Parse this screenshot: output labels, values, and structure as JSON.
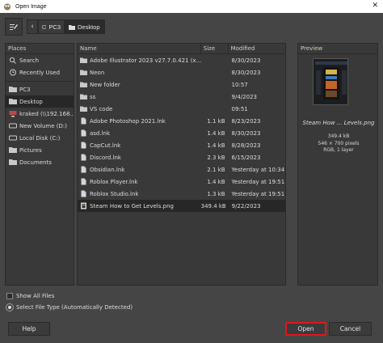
{
  "window": {
    "title": "Open Image"
  },
  "breadcrumb": [
    {
      "label": "PC3",
      "icon": "drive-icon"
    },
    {
      "label": "Desktop",
      "icon": "folder-icon"
    }
  ],
  "places": {
    "header": "Places",
    "items": [
      {
        "label": "Search",
        "icon": "search-icon"
      },
      {
        "label": "Recently Used",
        "icon": "clock-icon"
      },
      {
        "label": "PC3",
        "icon": "folder-icon"
      },
      {
        "label": "Desktop",
        "icon": "folder-icon",
        "selected": true
      },
      {
        "label": "kraked (\\\\192.168....",
        "icon": "network-drive-icon"
      },
      {
        "label": "New Volume (D:)",
        "icon": "drive-icon"
      },
      {
        "label": "Local Disk (C:)",
        "icon": "drive-icon"
      },
      {
        "label": "Pictures",
        "icon": "folder-icon"
      },
      {
        "label": "Documents",
        "icon": "folder-icon"
      }
    ]
  },
  "files": {
    "headers": {
      "name": "Name",
      "size": "Size",
      "modified": "Modified"
    },
    "rows": [
      {
        "name": "Adobe Illustrator 2023 v27.7.0.421 (x...",
        "size": "",
        "modified": "8/30/2023",
        "icon": "folder-icon"
      },
      {
        "name": "Neon",
        "size": "",
        "modified": "8/30/2023",
        "icon": "folder-icon"
      },
      {
        "name": "New folder",
        "size": "",
        "modified": "10:57",
        "icon": "folder-icon"
      },
      {
        "name": "ss",
        "size": "",
        "modified": "9/4/2023",
        "icon": "folder-icon"
      },
      {
        "name": "VS code",
        "size": "",
        "modified": "09:51",
        "icon": "folder-icon"
      },
      {
        "name": "Adobe Photoshop 2021.lnk",
        "size": "1.1 kB",
        "modified": "8/23/2023",
        "icon": "file-icon"
      },
      {
        "name": "asd.lnk",
        "size": "1.4 kB",
        "modified": "8/30/2023",
        "icon": "file-icon"
      },
      {
        "name": "CapCut.lnk",
        "size": "1.4 kB",
        "modified": "8/28/2023",
        "icon": "file-icon"
      },
      {
        "name": "Discord.lnk",
        "size": "2.3 kB",
        "modified": "6/15/2023",
        "icon": "file-icon"
      },
      {
        "name": "Obsidian.lnk",
        "size": "2.1 kB",
        "modified": "Yesterday at 10:34",
        "icon": "file-icon"
      },
      {
        "name": "Roblox Player.lnk",
        "size": "1.4 kB",
        "modified": "Yesterday at 19:51",
        "icon": "file-icon"
      },
      {
        "name": "Roblox Studio.lnk",
        "size": "1.3 kB",
        "modified": "Yesterday at 19:51",
        "icon": "file-icon"
      },
      {
        "name": "Steam How to Get Levels.png",
        "size": "349.4 kB",
        "modified": "9/22/2023",
        "icon": "image-file-icon",
        "selected": true
      }
    ]
  },
  "preview": {
    "header": "Preview",
    "name": "Steam How ... Levels.png",
    "size": "349.4 kB",
    "dimensions": "546 × 700 pixels",
    "mode": "RGB, 1 layer"
  },
  "options": {
    "show_all_files": "Show All Files",
    "file_type": "Select File Type (Automatically Detected)"
  },
  "buttons": {
    "help": "Help",
    "open": "Open",
    "cancel": "Cancel"
  },
  "colors": {
    "background": "#454545",
    "panel": "#393939",
    "selection": "#272727",
    "highlight_border": "#e0161c"
  }
}
